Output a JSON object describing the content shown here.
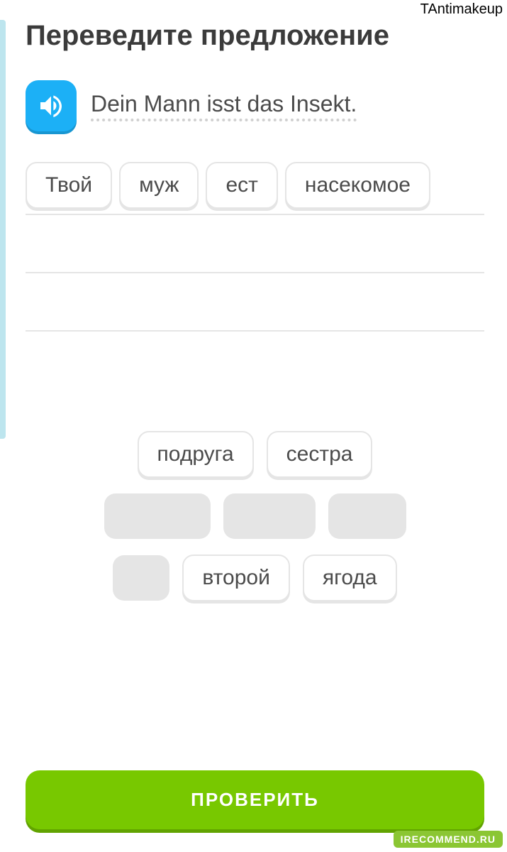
{
  "watermark_top": "TAntimakeup",
  "watermark_bottom": "IRECOMMEND.RU",
  "title": "Переведите предложение",
  "sentence": "Dein Mann isst das Insekt.",
  "answer_words": [
    "Твой",
    "муж",
    "ест",
    "насекомое"
  ],
  "bank": {
    "row1": [
      "подруга",
      "сестра"
    ],
    "row3": [
      "второй",
      "ягода"
    ]
  },
  "check_label": "ПРОВЕРИТЬ",
  "colors": {
    "accent": "#1cb0f6",
    "primary": "#78c800"
  }
}
